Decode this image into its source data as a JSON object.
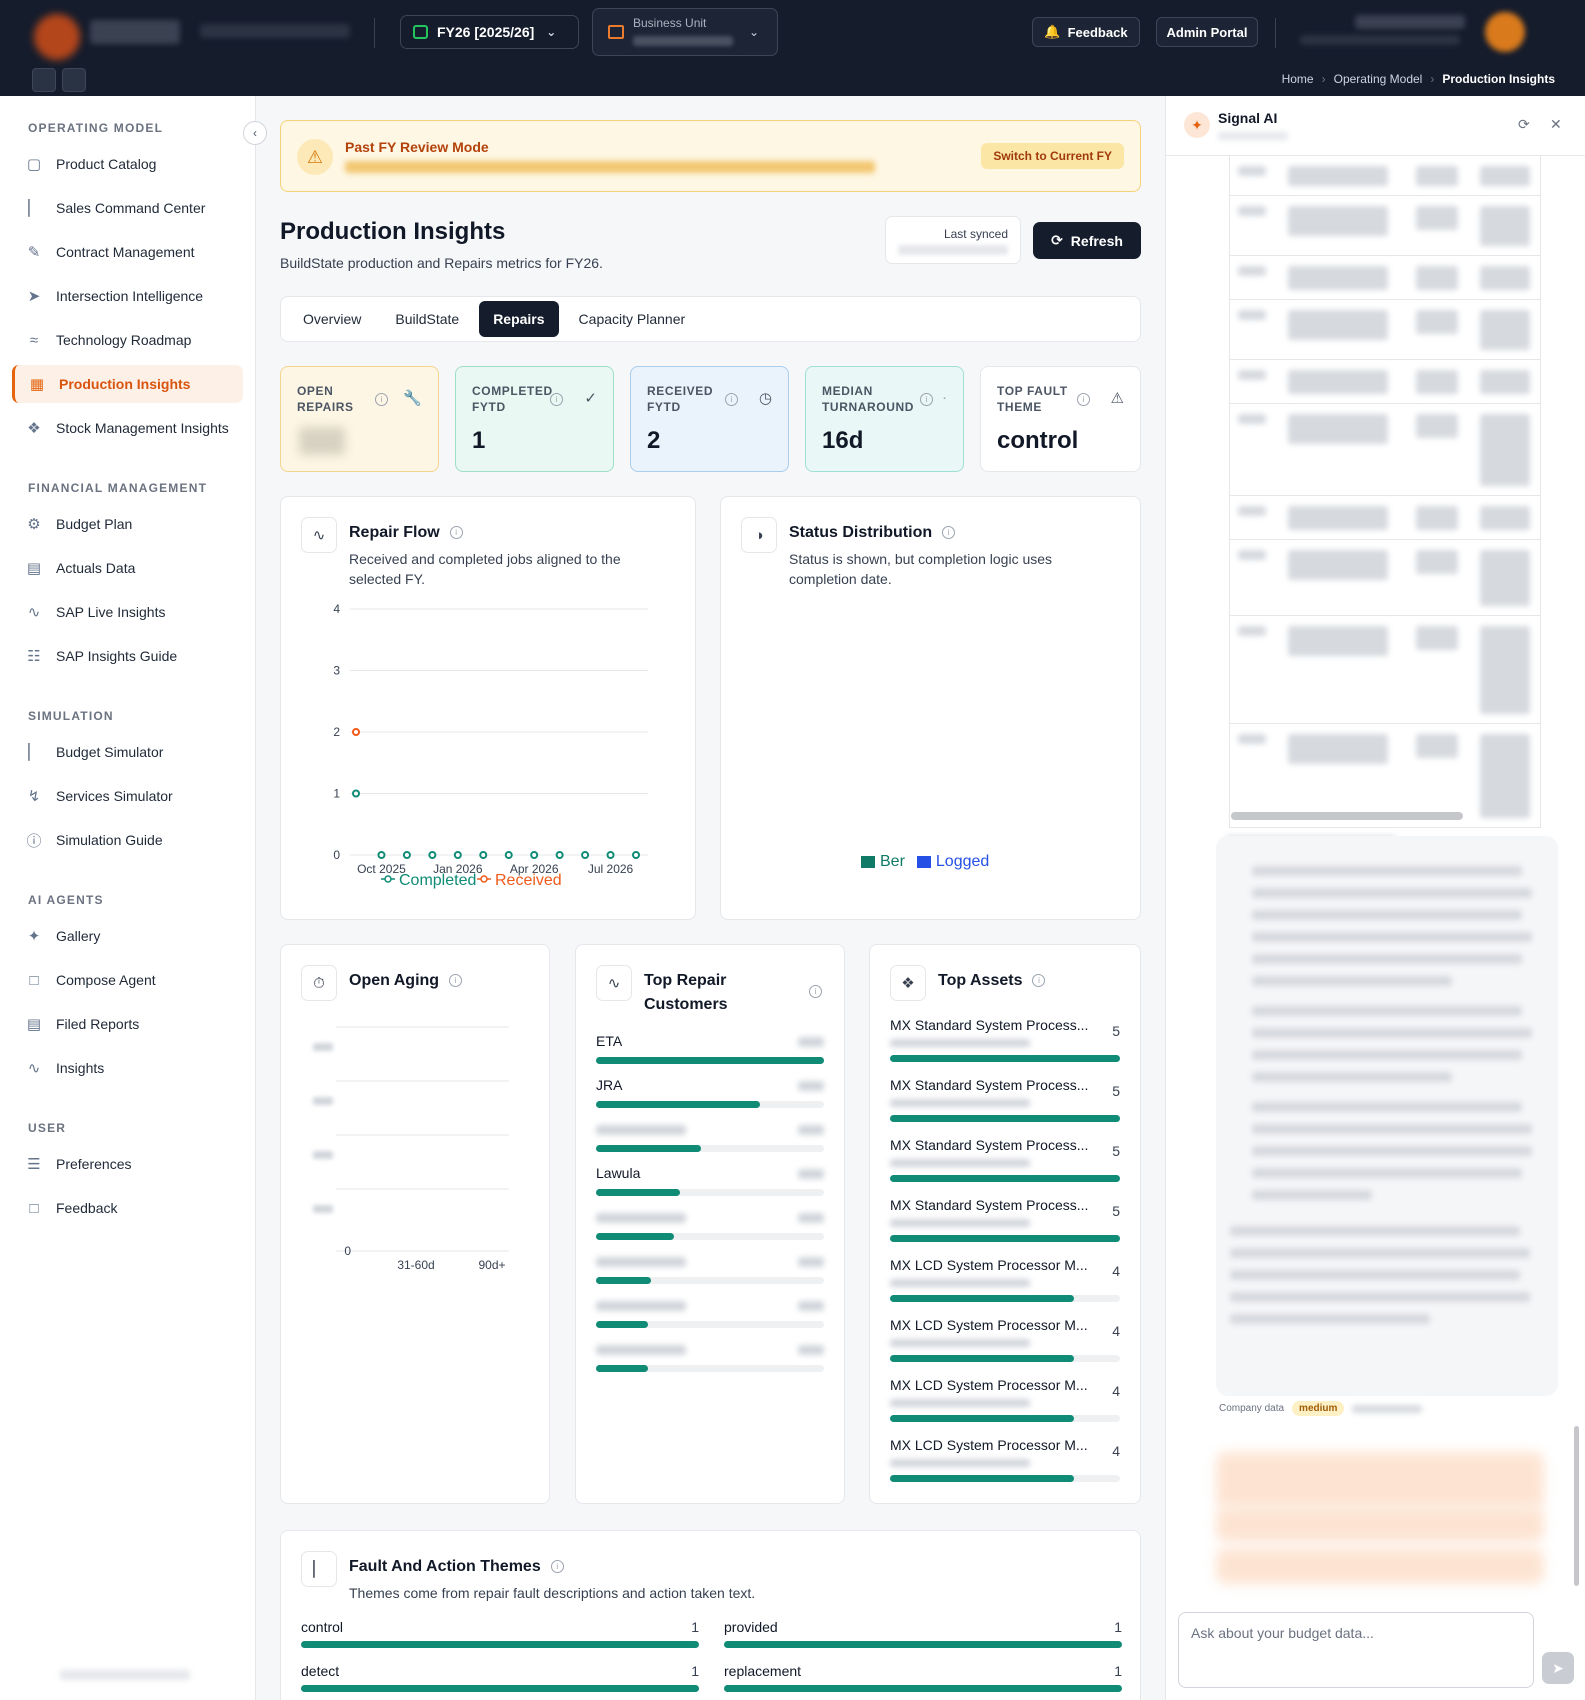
{
  "topbar": {
    "fiscal_year": "FY26 [2025/26]",
    "business_unit_label": "Business Unit",
    "feedback_label": "Feedback",
    "admin_portal_label": "Admin Portal"
  },
  "breadcrumb": [
    "Home",
    "Operating Model",
    "Production Insights"
  ],
  "sidebar": {
    "sections": [
      {
        "title": "OPERATING MODEL",
        "items": [
          "Product Catalog",
          "Sales Command Center",
          "Contract Management",
          "Intersection Intelligence",
          "Technology Roadmap",
          "Production Insights",
          "Stock Management Insights"
        ]
      },
      {
        "title": "FINANCIAL MANAGEMENT",
        "items": [
          "Budget Plan",
          "Actuals Data",
          "SAP Live Insights",
          "SAP Insights Guide"
        ]
      },
      {
        "title": "SIMULATION",
        "items": [
          "Budget Simulator",
          "Services Simulator",
          "Simulation Guide"
        ]
      },
      {
        "title": "AI AGENTS",
        "items": [
          "Gallery",
          "Compose Agent",
          "Filed Reports",
          "Insights"
        ]
      },
      {
        "title": "USER",
        "items": [
          "Preferences",
          "Feedback"
        ]
      }
    ],
    "active_item": "Production Insights"
  },
  "banner": {
    "title": "Past FY Review Mode",
    "button": "Switch to Current FY"
  },
  "page": {
    "title": "Production Insights",
    "subtitle": "BuildState production and Repairs metrics for FY26.",
    "last_synced_label": "Last synced",
    "refresh_label": "Refresh"
  },
  "tabs": [
    "Overview",
    "BuildState",
    "Repairs",
    "Capacity Planner"
  ],
  "active_tab": "Repairs",
  "kpis": [
    {
      "label": "OPEN REPAIRS",
      "value": "",
      "icon": "wrench-icon"
    },
    {
      "label": "COMPLETED FYTD",
      "value": "1",
      "icon": "check-circle-icon"
    },
    {
      "label": "RECEIVED FYTD",
      "value": "2",
      "icon": "calendar-clock-icon"
    },
    {
      "label": "MEDIAN TURNAROUND",
      "value": "16d",
      "icon": "trend-icon"
    },
    {
      "label": "TOP FAULT THEME",
      "value": "control",
      "icon": "alert-triangle-icon"
    }
  ],
  "repair_flow": {
    "title": "Repair Flow",
    "subtitle": "Received and completed jobs aligned to the selected FY."
  },
  "status_distribution": {
    "title": "Status Distribution",
    "subtitle": "Status is shown, but completion logic uses completion date."
  },
  "open_aging": {
    "title": "Open Aging"
  },
  "top_customers": {
    "title": "Top Repair Customers",
    "items": [
      {
        "label": "ETA",
        "fraction": 1.0
      },
      {
        "label": "JRA",
        "fraction": 0.72
      },
      {
        "label": "",
        "fraction": 0.46
      },
      {
        "label": "Lawula",
        "fraction": 0.37
      },
      {
        "label": "",
        "fraction": 0.34
      },
      {
        "label": "",
        "fraction": 0.24
      },
      {
        "label": "",
        "fraction": 0.23
      },
      {
        "label": "",
        "fraction": 0.23
      }
    ]
  },
  "top_assets": {
    "title": "Top Assets",
    "items": [
      {
        "label": "MX Standard System Process...",
        "count": "5",
        "fraction": 1.0
      },
      {
        "label": "MX Standard System Process...",
        "count": "5",
        "fraction": 1.0
      },
      {
        "label": "MX Standard System Process...",
        "count": "5",
        "fraction": 1.0
      },
      {
        "label": "MX Standard System Process...",
        "count": "5",
        "fraction": 1.0
      },
      {
        "label": "MX LCD System Processor M...",
        "count": "4",
        "fraction": 0.8
      },
      {
        "label": "MX LCD System Processor M...",
        "count": "4",
        "fraction": 0.8
      },
      {
        "label": "MX LCD System Processor M...",
        "count": "4",
        "fraction": 0.8
      },
      {
        "label": "MX LCD System Processor M...",
        "count": "4",
        "fraction": 0.8
      }
    ]
  },
  "fault_themes": {
    "title": "Fault And Action Themes",
    "subtitle": "Themes come from repair fault descriptions and action taken text.",
    "items": [
      {
        "label": "control",
        "count": "1",
        "fraction": 1.0
      },
      {
        "label": "provided",
        "count": "1",
        "fraction": 1.0
      },
      {
        "label": "detect",
        "count": "1",
        "fraction": 1.0
      },
      {
        "label": "replacement",
        "count": "1",
        "fraction": 1.0
      }
    ]
  },
  "signal_ai": {
    "title": "Signal AI",
    "source_label": "Company data",
    "confidence": "medium",
    "input_placeholder": "Ask about your budget data..."
  },
  "colors": {
    "accent": "#e4640f",
    "bar": "#0f8b76",
    "navy": "#151c2c"
  },
  "chart_data": [
    {
      "type": "line",
      "title": "Repair Flow",
      "x": [
        "Sep 2025",
        "Oct 2025",
        "Nov 2025",
        "Dec 2025",
        "Jan 2026",
        "Feb 2026",
        "Mar 2026",
        "Apr 2026",
        "May 2026",
        "Jun 2026",
        "Jul 2026",
        "Aug 2026"
      ],
      "tick_labels": [
        "Oct 2025",
        "Jan 2026",
        "Apr 2026",
        "Jul 2026"
      ],
      "series": [
        {
          "name": "Completed",
          "color": "#0f8b76",
          "values": [
            1,
            0,
            0,
            0,
            0,
            0,
            0,
            0,
            0,
            0,
            0,
            0
          ]
        },
        {
          "name": "Received",
          "color": "#ef5a1a",
          "values": [
            2,
            0,
            0,
            0,
            0,
            0,
            0,
            0,
            0,
            0,
            0,
            0
          ]
        }
      ],
      "ylim": [
        0,
        4
      ],
      "yticks": [
        "0",
        "1",
        "2",
        "3",
        "4"
      ],
      "grid": true,
      "legend": "bottom"
    },
    {
      "type": "bar",
      "title": "Status Distribution",
      "series": [
        {
          "name": "Ber",
          "color": "#0f7a65"
        },
        {
          "name": "Logged",
          "color": "#2450e6"
        }
      ],
      "legend": "bottom"
    },
    {
      "type": "bar",
      "title": "Open Aging",
      "categories": [
        "31-60d",
        "90d+"
      ],
      "yticks": [
        "0"
      ],
      "grid": true
    }
  ]
}
